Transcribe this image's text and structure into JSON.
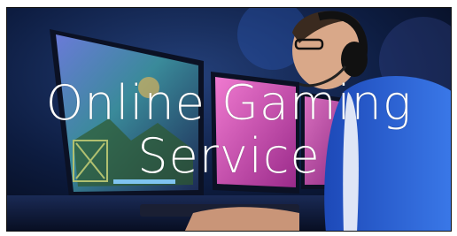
{
  "banner": {
    "title_line1": "Online Gaming",
    "title_line2": "Service",
    "image_subject": "gamer-playing-at-monitor",
    "colors": {
      "background": "#0a1530",
      "accent_pink": "#d63aa6",
      "accent_blue": "#2b5fd9",
      "title": "#ffffff"
    }
  }
}
